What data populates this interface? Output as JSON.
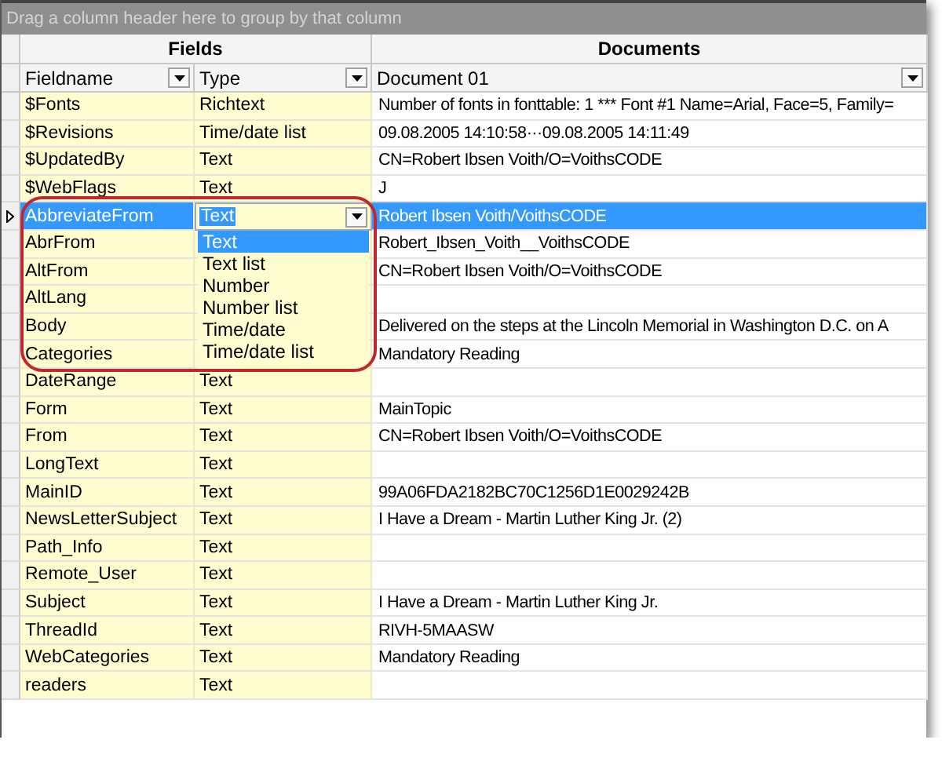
{
  "group_panel": {
    "hint": "Drag a column header here to group by that column"
  },
  "bands": [
    {
      "label": "Fields"
    },
    {
      "label": "Documents"
    }
  ],
  "columns": [
    {
      "label": "Fieldname"
    },
    {
      "label": "Type"
    },
    {
      "label": "Document 01"
    }
  ],
  "rows": [
    {
      "fieldname": "$Fonts",
      "type": "Richtext",
      "value": "Number of fonts in fonttable: 1 *** Font #1 Name=Arial, Face=5, Family=",
      "selected": false
    },
    {
      "fieldname": "$Revisions",
      "type": "Time/date list",
      "value": "09.08.2005 14:10:58···09.08.2005 14:11:49",
      "selected": false
    },
    {
      "fieldname": "$UpdatedBy",
      "type": "Text",
      "value": "CN=Robert Ibsen Voith/O=VoithsCODE",
      "selected": false
    },
    {
      "fieldname": "$WebFlags",
      "type": "Text",
      "value": "J",
      "selected": false
    },
    {
      "fieldname": "AbbreviateFrom",
      "type": "Text",
      "value": "Robert Ibsen Voith/VoithsCODE",
      "selected": true
    },
    {
      "fieldname": "AbrFrom",
      "value": "Robert_Ibsen_Voith__VoithsCODE",
      "selected": false
    },
    {
      "fieldname": "AltFrom",
      "value": "CN=Robert Ibsen Voith/O=VoithsCODE",
      "selected": false
    },
    {
      "fieldname": "AltLang",
      "selected": false
    },
    {
      "fieldname": "Body",
      "value": "Delivered on the steps at the Lincoln Memorial in Washington D.C. on A",
      "selected": false
    },
    {
      "fieldname": "Categories",
      "value": "Mandatory Reading",
      "selected": false
    },
    {
      "fieldname": "DateRange",
      "type": "Text",
      "selected": false
    },
    {
      "fieldname": "Form",
      "type": "Text",
      "value": "MainTopic",
      "selected": false
    },
    {
      "fieldname": "From",
      "type": "Text",
      "value": "CN=Robert Ibsen Voith/O=VoithsCODE",
      "selected": false
    },
    {
      "fieldname": "LongText",
      "type": "Text",
      "selected": false
    },
    {
      "fieldname": "MainID",
      "type": "Text",
      "value": "99A06FDA2182BC70C1256D1E0029242B",
      "selected": false
    },
    {
      "fieldname": "NewsLetterSubject",
      "type": "Text",
      "value": "I Have a Dream - Martin Luther King Jr. (2)",
      "selected": false
    },
    {
      "fieldname": "Path_Info",
      "type": "Text",
      "selected": false
    },
    {
      "fieldname": "Remote_User",
      "type": "Text",
      "selected": false
    },
    {
      "fieldname": "Subject",
      "type": "Text",
      "value": "I Have a Dream - Martin Luther King Jr.",
      "selected": false
    },
    {
      "fieldname": "ThreadId",
      "type": "Text",
      "value": "RIVH-5MAASW",
      "selected": false
    },
    {
      "fieldname": "WebCategories",
      "type": "Text",
      "value": "Mandatory Reading",
      "selected": false
    },
    {
      "fieldname": "readers",
      "type": "Text",
      "selected": false
    }
  ],
  "dropdown": {
    "options": [
      {
        "label": "Text",
        "selected": true
      },
      {
        "label": "Text list",
        "selected": false
      },
      {
        "label": "Number",
        "selected": false
      },
      {
        "label": "Number list",
        "selected": false
      },
      {
        "label": "Time/date",
        "selected": false
      },
      {
        "label": "Time/date list",
        "selected": false
      }
    ]
  }
}
